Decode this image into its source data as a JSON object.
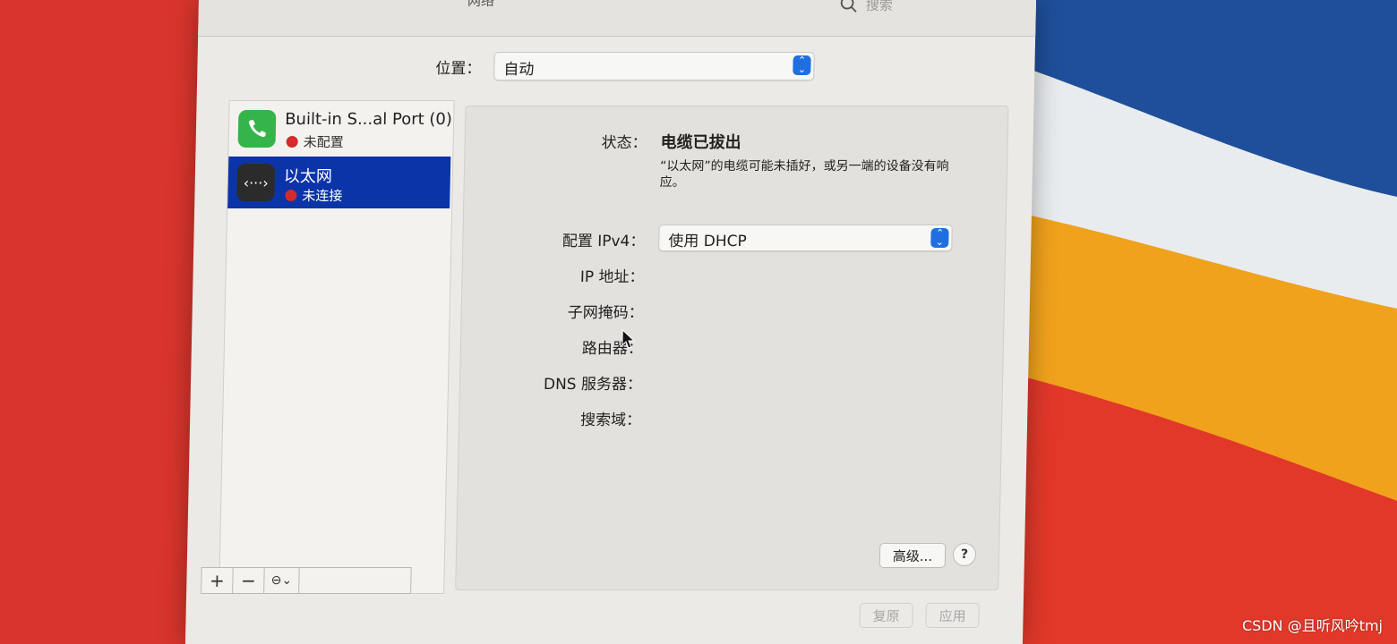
{
  "window": {
    "title": "网络"
  },
  "search": {
    "placeholder": "搜索"
  },
  "location": {
    "label": "位置：",
    "value": "自动"
  },
  "services": [
    {
      "name": "Built-in S...al Port (0)",
      "status": "未配置",
      "icon": "phone-icon",
      "selected": false
    },
    {
      "name": "以太网",
      "status": "未连接",
      "icon": "ethernet-icon",
      "selected": true
    }
  ],
  "sidebar_tools": {
    "add": "+",
    "remove": "−",
    "action": "⊖⌄"
  },
  "detail": {
    "status_label": "状态：",
    "status_value": "电缆已拔出",
    "status_desc": "“以太网”的电缆可能未插好，或另一端的设备没有响应。",
    "ipv4_label": "配置 IPv4：",
    "ipv4_value": "使用 DHCP",
    "ip_label": "IP 地址：",
    "subnet_label": "子网掩码：",
    "router_label": "路由器：",
    "dns_label": "DNS 服务器：",
    "search_domain_label": "搜索域："
  },
  "buttons": {
    "advanced": "高级...",
    "help": "?",
    "revert": "复原",
    "apply": "应用"
  },
  "watermark": "CSDN @且听风吟tmj",
  "colors": {
    "accent": "#1f6fe0",
    "selection": "#0b34a8",
    "status_red": "#d42c2c"
  }
}
